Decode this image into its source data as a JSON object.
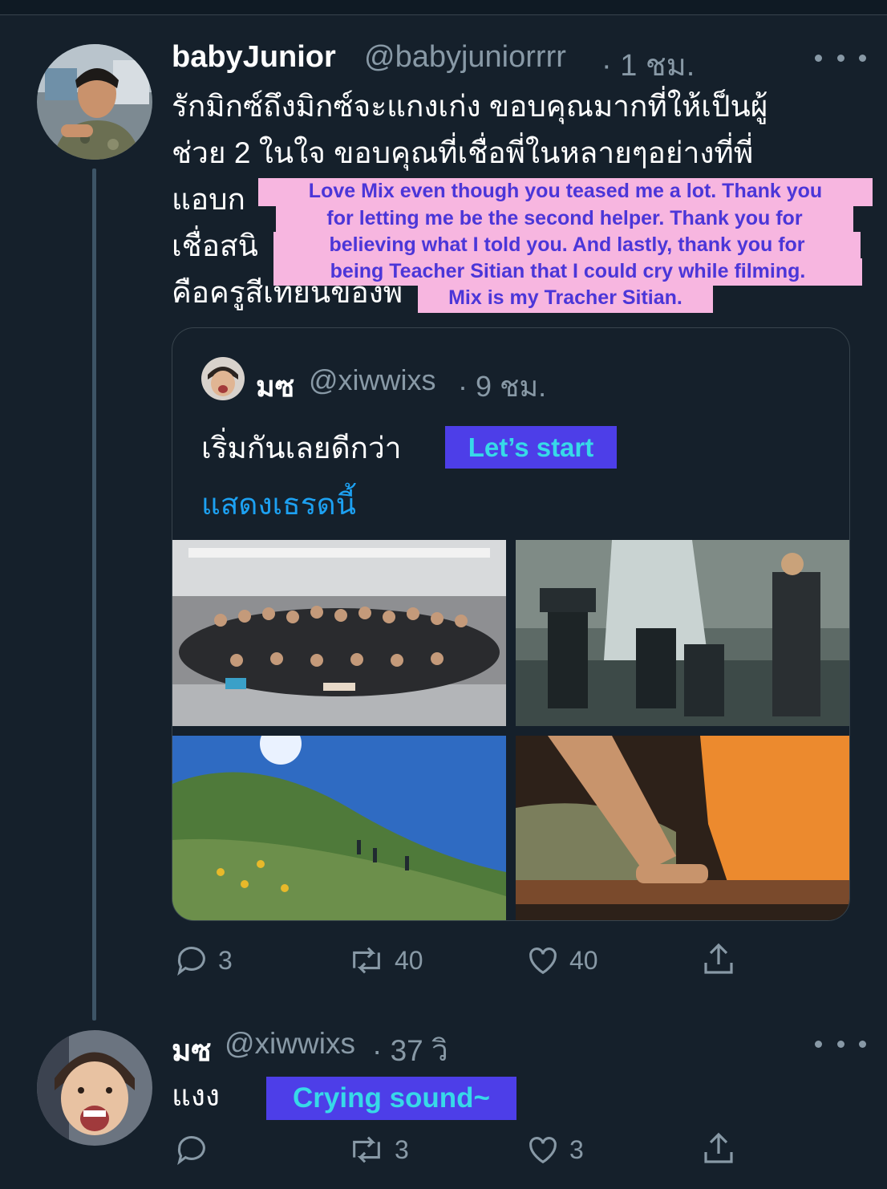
{
  "tweet": {
    "author_name": "babyJunior",
    "author_handle": "@babyjuniorrrr",
    "time": "· 1 ชม.",
    "text_lines": [
      "รักมิกซ์ถึงมิกซ์จะแกงเก่ง ขอบคุณมากที่ให้เป็นผู้",
      "ช่วย 2 ในใจ ขอบคุณที่เชื่อพี่ในหลายๆอย่างที่พี่",
      "แอบก",
      "เชื่อสนิ",
      "คือครูสีเทียนของพ"
    ],
    "translation_lines": [
      "Love Mix even though you teased me a lot. Thank you",
      "for letting me be the second helper. Thank you for",
      "believing what I told you. And lastly, thank you for",
      "being Teacher Sitian that I could cry while filming.",
      "Mix is my Tracher Sitian."
    ],
    "quoted": {
      "author_name": "มซ",
      "author_handle": "@xiwwixs",
      "time": "· 9 ชม.",
      "text": "เริ่มกันเลยดีกว่า",
      "translation": "Let’s start",
      "show_thread": "แสดงเธรดนี้"
    },
    "actions": {
      "reply": "3",
      "retweet": "40",
      "like": "40"
    }
  },
  "reply": {
    "author_name": "มซ",
    "author_handle": "@xiwwixs",
    "time": "· 37 วิ",
    "text": "แงง",
    "translation": "Crying sound~",
    "actions": {
      "reply": "",
      "retweet": "3",
      "like": "3"
    }
  },
  "colors": {
    "background": "#15202b",
    "secondary_text": "#8899a6",
    "link": "#1da1f2",
    "overlay_pink": "#f7b6e0",
    "overlay_text": "#4b36d8",
    "label_bg": "#4d3ee8",
    "label_text": "#37d9e8"
  }
}
